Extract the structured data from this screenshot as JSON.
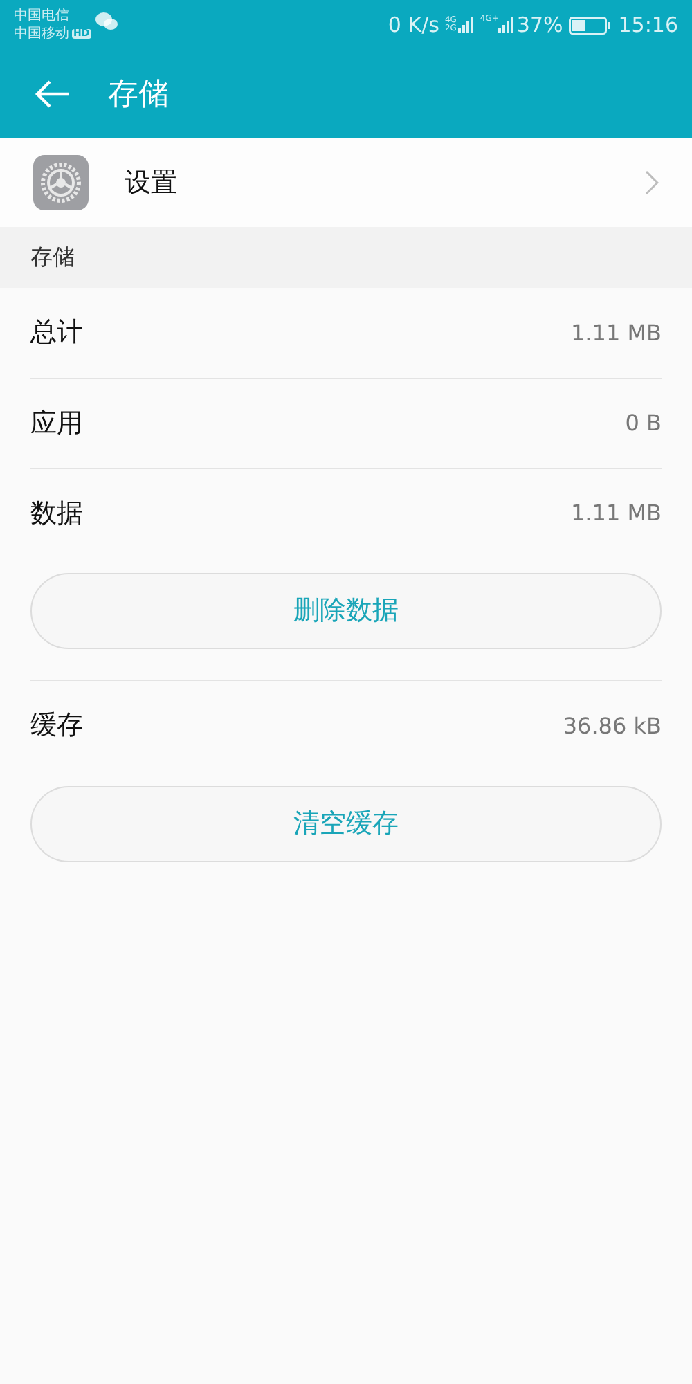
{
  "status_bar": {
    "carriers": [
      "中国电信",
      "中国移动"
    ],
    "hd_badge": "HD",
    "speed": "0 K/s",
    "sim1_network": [
      "4G",
      "2G"
    ],
    "sim2_network": "4G+",
    "battery_percent": "37%",
    "time": "15:16"
  },
  "app_bar": {
    "title": "存储"
  },
  "app_row": {
    "label": "设置"
  },
  "section": {
    "title": "存储"
  },
  "items": [
    {
      "kind": "row",
      "label": "总计",
      "value": "1.11 MB"
    },
    {
      "kind": "row",
      "label": "应用",
      "value": "0 B"
    },
    {
      "kind": "row",
      "label": "数据",
      "value": "1.11 MB"
    },
    {
      "kind": "button",
      "label": "删除数据"
    },
    {
      "kind": "divider"
    },
    {
      "kind": "row",
      "label": "缓存",
      "value": "36.86 kB"
    },
    {
      "kind": "button",
      "label": "清空缓存"
    }
  ]
}
